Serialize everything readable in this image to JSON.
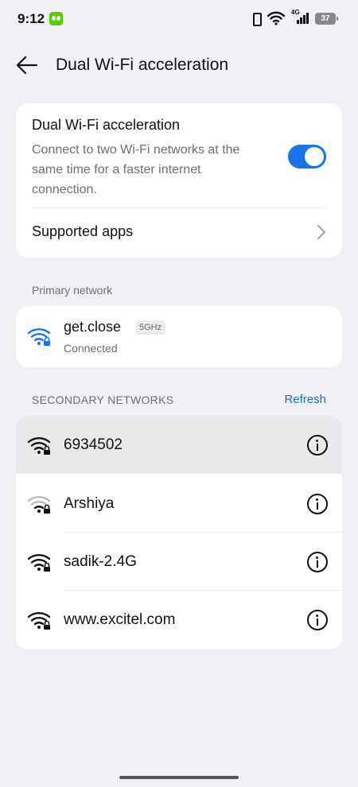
{
  "status_bar": {
    "time": "9:12",
    "app_icon": "duolingo-icon",
    "network_type": "4G",
    "battery": "37",
    "icons": [
      "vibrate-icon",
      "wifi-icon",
      "cellular-signal-icon",
      "battery-icon"
    ]
  },
  "header": {
    "title": "Dual Wi-Fi acceleration",
    "back_icon": "back-arrow-icon"
  },
  "main_setting": {
    "title": "Dual Wi-Fi acceleration",
    "description": "Connect to two Wi-Fi networks at the same time for a faster internet connection.",
    "toggle_on": true,
    "supported_apps_label": "Supported apps"
  },
  "primary": {
    "section_label": "Primary network",
    "network": {
      "name": "get.close",
      "band": "5GHz",
      "status": "Connected"
    }
  },
  "secondary": {
    "section_label": "SECONDARY NETWORKS",
    "refresh_label": "Refresh",
    "networks": [
      {
        "name": "6934502",
        "selected": true
      },
      {
        "name": "Arshiya",
        "selected": false
      },
      {
        "name": "sadik-2.4G",
        "selected": false
      },
      {
        "name": "www.excitel.com",
        "selected": false
      }
    ]
  },
  "colors": {
    "accent": "#1a73e8",
    "background": "#f0f1f5",
    "card": "#ffffff",
    "secondary_text": "#6e6e73",
    "link": "#1a6fd0"
  }
}
